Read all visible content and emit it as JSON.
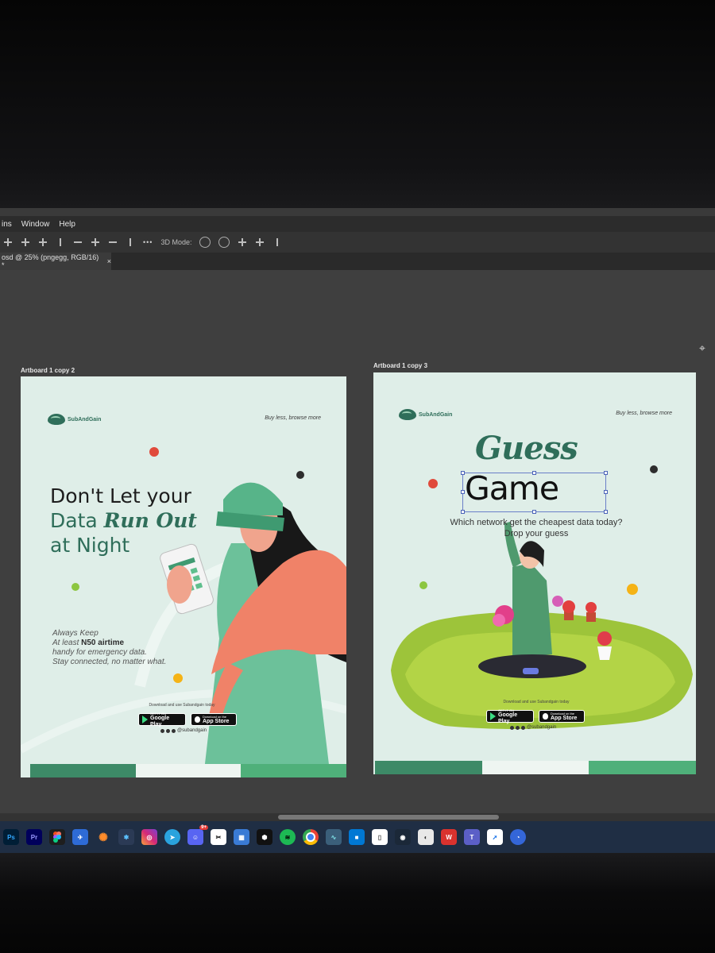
{
  "menubar": {
    "items": [
      "ins",
      "Window",
      "Help"
    ]
  },
  "options_bar": {
    "mode_label": "3D Mode:"
  },
  "document_tab": {
    "title": "osd @ 25% (pngegg, RGB/16) *",
    "close": "×"
  },
  "artboards": [
    {
      "label": "Artboard 1 copy 2",
      "brand": "SubAndGain",
      "tagline": "Buy less, browse more",
      "headline": {
        "line1": "Don't Let your",
        "line2_a": "Data ",
        "line2_b": "Run Out",
        "line3": "at Night"
      },
      "body": {
        "line1": "Always Keep",
        "line2_a": "At least ",
        "line2_b": "N50 airtime",
        "line3": "handy for emergency data.",
        "line4": "Stay connected, no matter what."
      },
      "download_text": "Download and use Subandgain today",
      "google_small": "GET IT ON",
      "google_big": "Google Play",
      "apple_small": "Download on the",
      "apple_big": "App Store",
      "handle": "@subandgain"
    },
    {
      "label": "Artboard 1 copy 3",
      "brand": "SubAndGain",
      "tagline": "Buy less, browse more",
      "title_a": "Guess",
      "title_b": "Game",
      "question_line1": "Which network get the cheapest data today?",
      "question_line2": "Drop your guess",
      "download_text": "Download and use Subandgain today",
      "google_small": "GET IT ON",
      "google_big": "Google Play",
      "apple_small": "Download on the",
      "apple_big": "App Store",
      "handle": "@subandgain"
    }
  ],
  "taskbar": {
    "apps": [
      "Ps",
      "Pr",
      "Figma",
      "Mail",
      "Sun",
      "Slack",
      "Instagram",
      "Telegram",
      "Discord",
      "CapCut",
      "Calendar",
      "Notion",
      "Spotify",
      "Chrome",
      "Terminal",
      "Windows",
      "Files",
      "Steam",
      "Camera",
      "WPS",
      "Teams",
      "Safari",
      "Firefox"
    ],
    "badge": "9+"
  },
  "colors": {
    "brand_green": "#2f6e5a",
    "light_green": "#5fbf8d",
    "artboard_bg": "#dfeee8"
  }
}
